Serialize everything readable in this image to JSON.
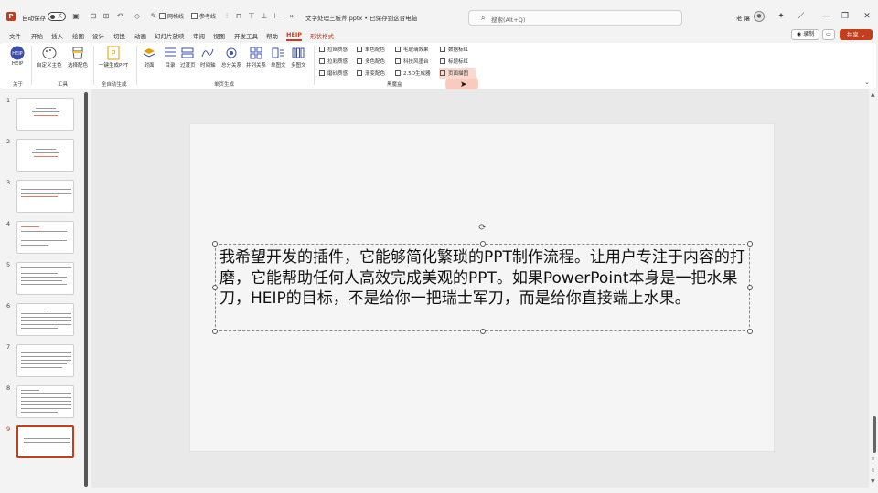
{
  "titlebar": {
    "app_logo": "P",
    "autosave_label": "自动保存",
    "autosave_state": "关",
    "checkbox_ref_line": "网格线",
    "checkbox_ref": "参考线",
    "doc_title": "文字处理三板斧.pptx • 已保存到这台电脑",
    "search_placeholder": "搜索(Alt+Q)",
    "user_name": "老 屠"
  },
  "menu": {
    "tabs": [
      "文件",
      "开始",
      "插入",
      "绘图",
      "设计",
      "切换",
      "动画",
      "幻灯片放映",
      "审阅",
      "视图",
      "开发工具",
      "帮助",
      "HEIP",
      "形状格式"
    ],
    "active_tab": "HEIP",
    "record_label": "录制",
    "share_label": "共享"
  },
  "ribbon": {
    "heip_label": "HEIP",
    "custom_theme_label": "自定义主色",
    "pick_color_label": "选择配色",
    "one_click_label": "一键生成PPT",
    "cover_label": "封面",
    "toc_label": "目录",
    "transition_label": "过渡页",
    "timeline_label": "时间轴",
    "total_split_label": "总分关系",
    "parallel_label": "并列关系",
    "single_image_label": "单图文",
    "multi_image_label": "多图文",
    "small_buttons": [
      [
        "拉丝质感",
        "单色配色",
        "毛玻璃效果",
        "数据标红"
      ],
      [
        "拉彩质感",
        "多色配色",
        "科技风墨台",
        "标题标红"
      ],
      [
        "磨砂质感",
        "渐变配色",
        "2.5D生成器",
        "页面描图"
      ]
    ],
    "group_labels": [
      "关于",
      "工具",
      "全自动生成",
      "单页生成",
      "黑魔盒"
    ]
  },
  "thumbnails": {
    "numbers": [
      "1",
      "2",
      "3",
      "4",
      "5",
      "6",
      "7",
      "8",
      "9"
    ],
    "selected": "9"
  },
  "slide": {
    "text": "我希望开发的插件，它能够简化繁琐的PPT制作流程。让用户专注于内容的打磨，它能帮助任何人高效完成美观的PPT。如果PowerPoint本身是一把水果刀，HEIP的目标，不是给你一把瑞士军刀，而是给你直接端上水果。"
  },
  "colors": {
    "accent": "#c43e1c",
    "ribbon_bg": "#ffffff",
    "chrome_bg": "#f3f3f3"
  }
}
